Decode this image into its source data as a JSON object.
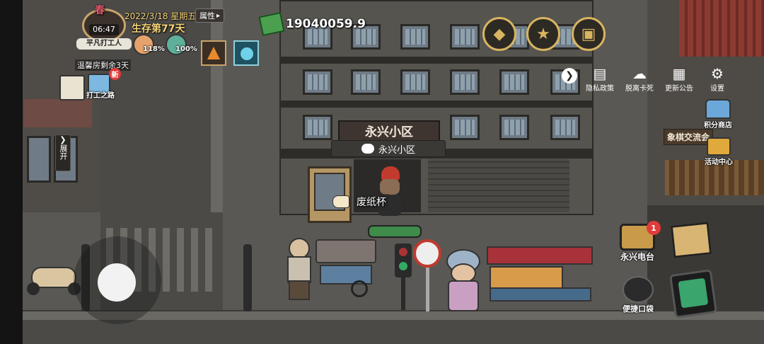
{
  "hud": {
    "clock": "06:47",
    "season_char": "春",
    "date_line": "2022/3/18 星期五",
    "survival": "生存第77天",
    "attr_button": "属性",
    "player_title": "平凡打工人",
    "hunger_pct": "118%",
    "energy_pct": "100%",
    "money": "19040059.9",
    "warm_room": "温馨房剩余3天",
    "new_badge": "新",
    "work_road": "打工之路",
    "expand_label": "展开"
  },
  "top_menu": {
    "privacy": "隐私政策",
    "escape": "脱离卡死",
    "announcement": "更新公告",
    "settings": "设置"
  },
  "right_menu": {
    "points_shop": "积分商店",
    "chess_exchange": "象棋交流会",
    "activity_center": "活动中心",
    "radio": "永兴电台",
    "radio_badge": "1",
    "pocket": "便捷口袋"
  },
  "scene": {
    "community_sign": "永兴小区",
    "location_bubble": "永兴小区",
    "item_label": "废纸杯"
  },
  "icons": {
    "map": "map-icon",
    "trophy": "trophy-icon",
    "backpack": "backpack-icon",
    "gear": "gear-icon"
  }
}
